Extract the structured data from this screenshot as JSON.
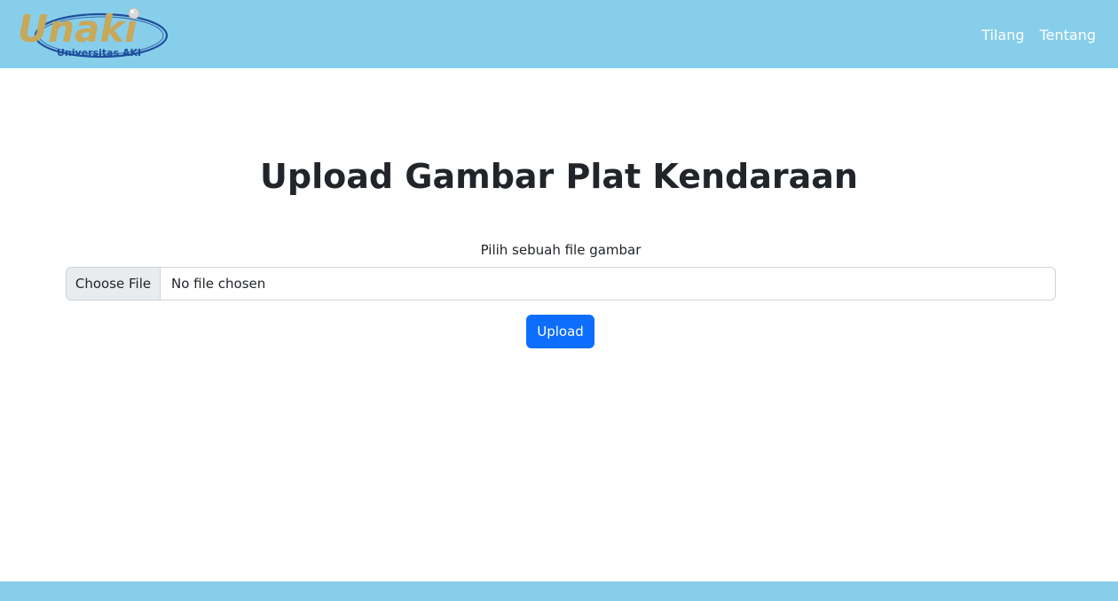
{
  "header": {
    "logo": {
      "wordmark": "Unaki",
      "tagline": "Universitas AKI"
    },
    "nav": [
      {
        "label": "Tilang"
      },
      {
        "label": "Tentang"
      }
    ]
  },
  "main": {
    "title": "Upload Gambar Plat Kendaraan",
    "file_label": "Pilih sebuah file gambar",
    "file_input": {
      "button_label": "Choose File",
      "status": "No file chosen"
    },
    "submit_label": "Upload"
  },
  "colors": {
    "navbar": "#87ceeb",
    "primary_button": "#0d6efd",
    "logo_gold": "#c8a85a",
    "logo_blue": "#1f4e9c"
  }
}
